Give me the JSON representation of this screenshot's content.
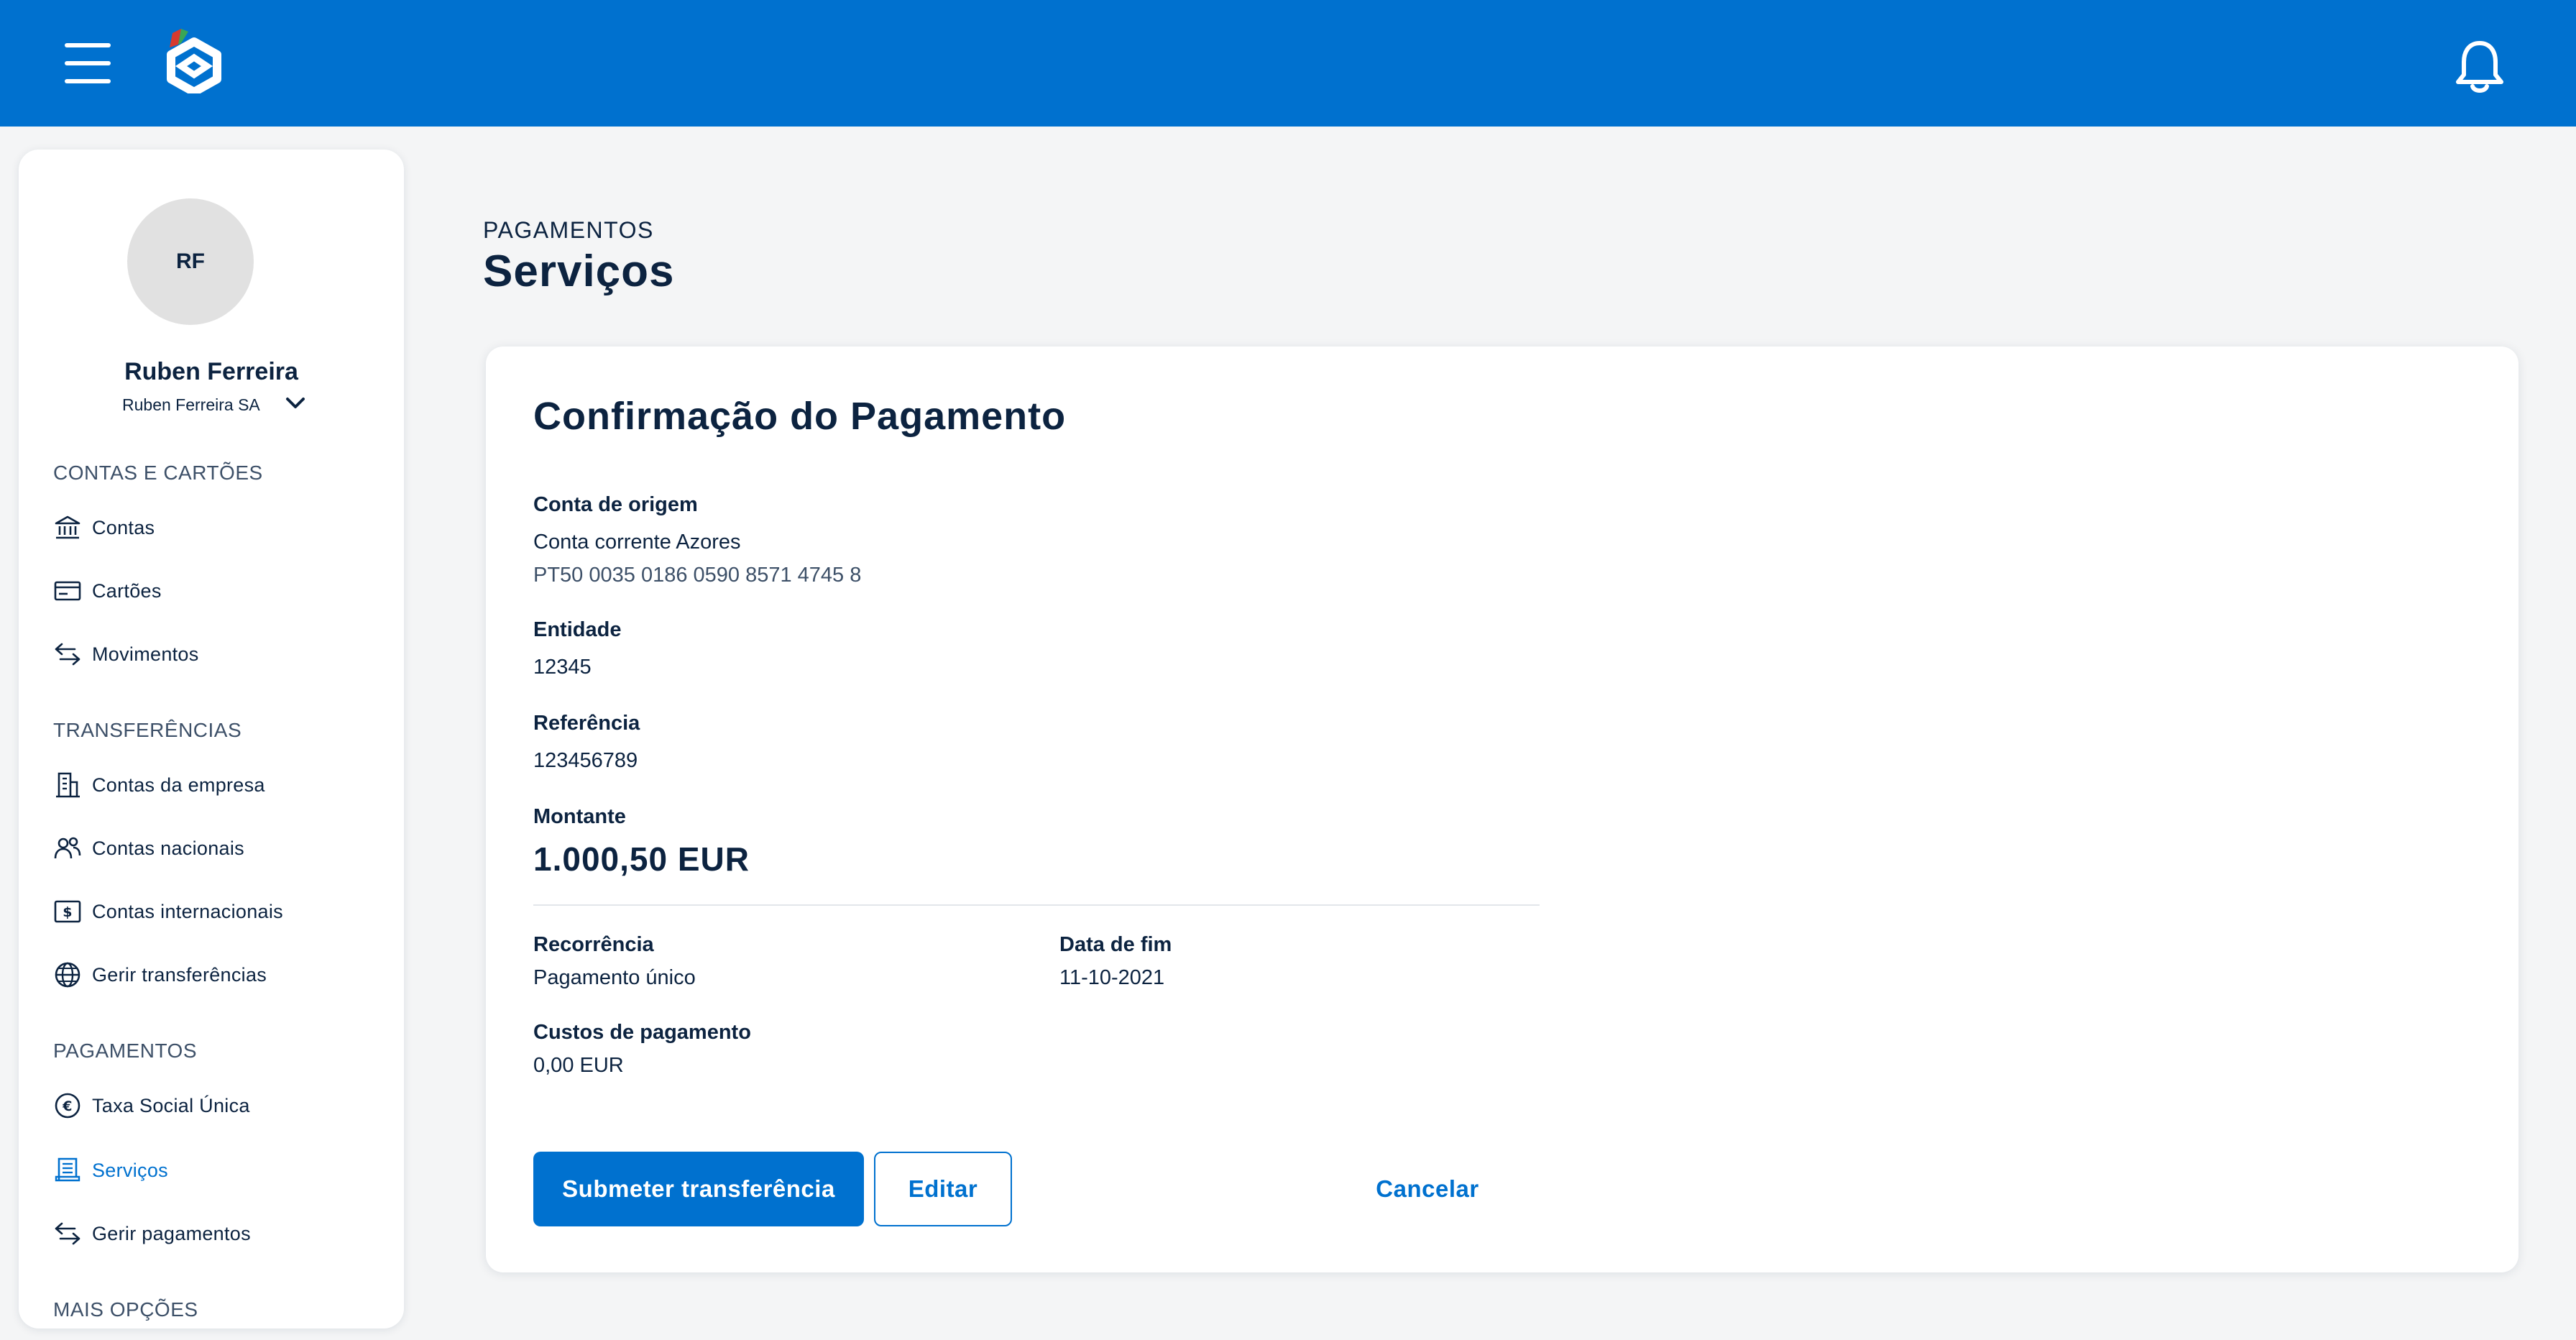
{
  "header": {
    "menu_icon": "menu-icon",
    "logo_icon": "bank-logo",
    "bell_icon": "bell-icon",
    "brand_color": "#0071cf"
  },
  "sidebar": {
    "avatar_initials": "RF",
    "user_name": "Ruben Ferreira",
    "company": "Ruben Ferreira SA",
    "sections": [
      {
        "title": "CONTAS E CARTÕES",
        "items": [
          {
            "label": "Contas",
            "icon": "bank-icon"
          },
          {
            "label": "Cartões",
            "icon": "card-icon"
          },
          {
            "label": "Movimentos",
            "icon": "arrows-icon"
          }
        ]
      },
      {
        "title": "TRANSFERÊNCIAS",
        "items": [
          {
            "label": "Contas da empresa",
            "icon": "building-icon"
          },
          {
            "label": "Contas nacionais",
            "icon": "people-icon"
          },
          {
            "label": "Contas internacionais",
            "icon": "dollar-note-icon"
          },
          {
            "label": "Gerir transferências",
            "icon": "globe-icon"
          }
        ]
      },
      {
        "title": "PAGAMENTOS",
        "items": [
          {
            "label": "Taxa Social Única",
            "icon": "euro-icon"
          },
          {
            "label": "Serviços",
            "icon": "receipt-icon",
            "active": true
          },
          {
            "label": "Gerir pagamentos",
            "icon": "arrows-icon"
          }
        ]
      },
      {
        "title": "MAIS OPÇÕES",
        "items": []
      }
    ]
  },
  "main": {
    "breadcrumb": "PAGAMENTOS",
    "title": "Serviços",
    "card": {
      "title": "Confirmação do Pagamento",
      "conta_origem": {
        "label": "Conta de origem",
        "name": "Conta corrente Azores",
        "iban": "PT50 0035 0186 0590 8571 4745 8"
      },
      "entidade": {
        "label": "Entidade",
        "value": "12345"
      },
      "referencia": {
        "label": "Referência",
        "value": "123456789"
      },
      "montante": {
        "label": "Montante",
        "value": "1.000,50 EUR"
      },
      "recorrencia": {
        "label": "Recorrência",
        "value": "Pagamento único"
      },
      "data_fim": {
        "label": "Data de fim",
        "value": "11-10-2021"
      },
      "custos": {
        "label": "Custos de pagamento",
        "value": "0,00 EUR"
      },
      "actions": {
        "submit": "Submeter transferência",
        "edit": "Editar",
        "cancel": "Cancelar"
      }
    }
  }
}
